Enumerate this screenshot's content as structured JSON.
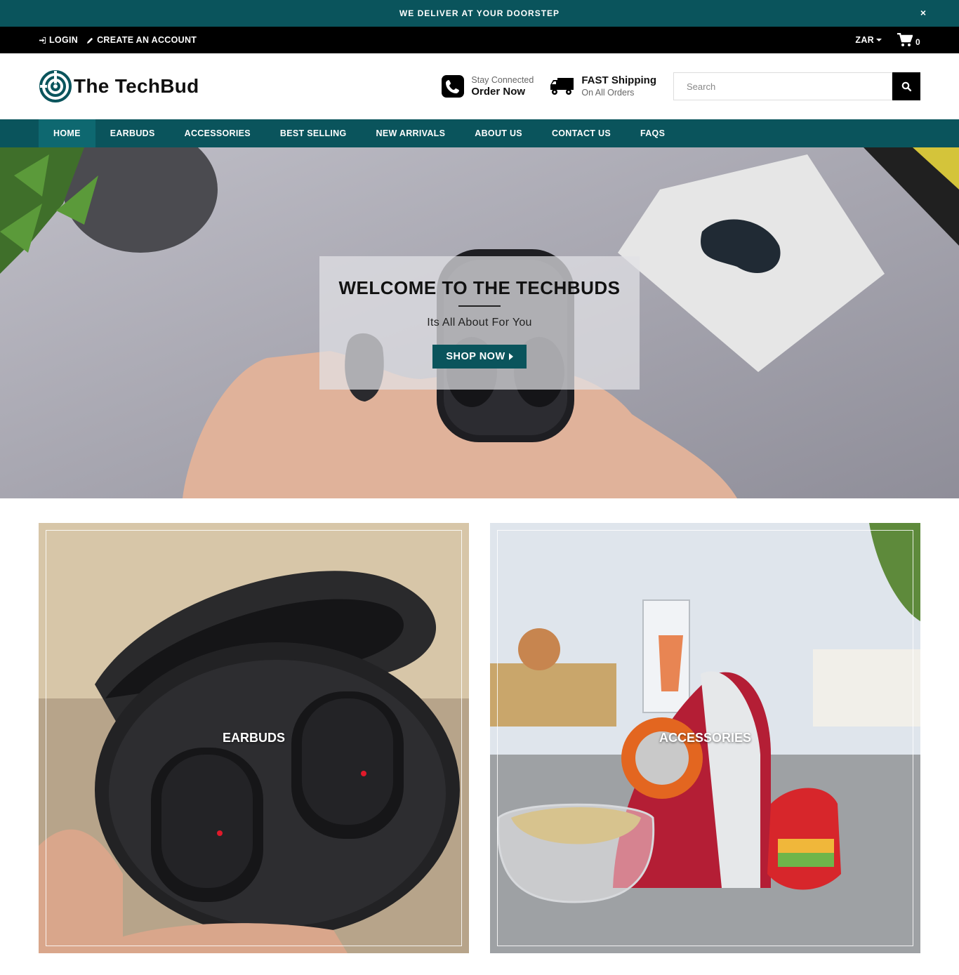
{
  "announcement": {
    "text": "WE DELIVER AT YOUR DOORSTEP",
    "close_glyph": "×"
  },
  "topbar": {
    "login_label": "LOGIN",
    "create_account_label": "CREATE AN ACCOUNT",
    "currency": "ZAR",
    "cart_count": "0"
  },
  "header": {
    "brand": "The TechBud",
    "contact": {
      "small": "Stay Connected",
      "big": "Order Now"
    },
    "shipping": {
      "big": "FAST Shipping",
      "small": "On All Orders"
    },
    "search_placeholder": "Search"
  },
  "nav": {
    "items": [
      {
        "label": "HOME",
        "active": true
      },
      {
        "label": "EARBUDS"
      },
      {
        "label": "ACCESSORIES"
      },
      {
        "label": "BEST SELLING"
      },
      {
        "label": "NEW ARRIVALS"
      },
      {
        "label": "ABOUT US"
      },
      {
        "label": "CONTACT US"
      },
      {
        "label": "FAQS"
      }
    ]
  },
  "hero": {
    "title": "WELCOME TO THE TECHBUDS",
    "subtitle": "Its All About For You",
    "button_label": "SHOP NOW"
  },
  "categories": [
    {
      "label": "EARBUDS"
    },
    {
      "label": "ACCESSORIES"
    }
  ],
  "colors": {
    "teal": "#0a545c",
    "black": "#000000"
  }
}
